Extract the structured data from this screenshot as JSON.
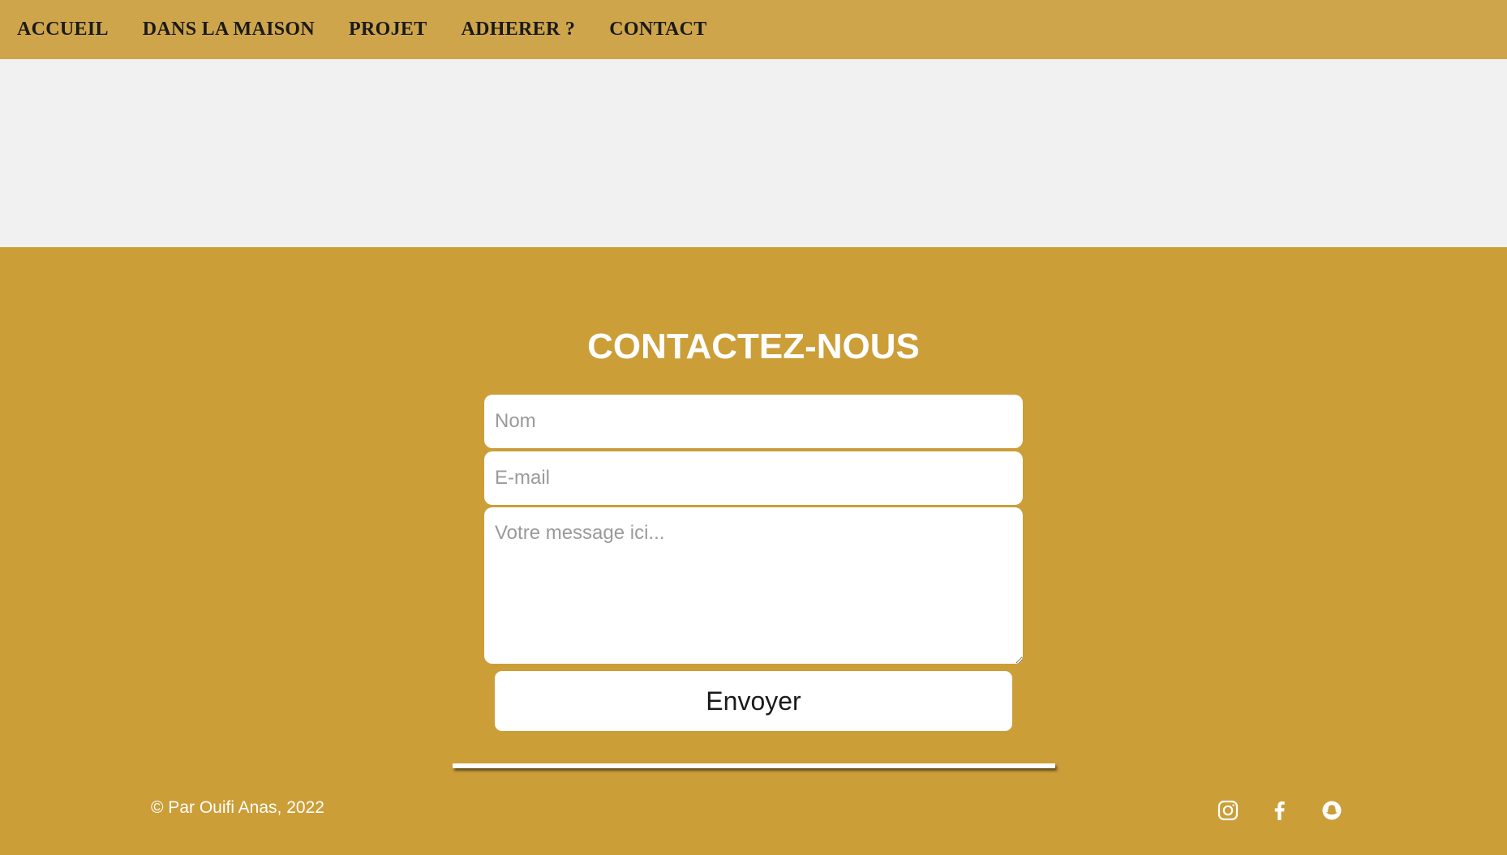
{
  "nav": {
    "items": [
      {
        "label": "ACCUEIL"
      },
      {
        "label": "DANS LA MAISON"
      },
      {
        "label": "PROJET"
      },
      {
        "label": "ADHERER ?"
      },
      {
        "label": "CONTACT"
      }
    ]
  },
  "contact": {
    "title": "CONTACTEZ-NOUS",
    "name_placeholder": "Nom",
    "email_placeholder": "E-mail",
    "message_placeholder": "Votre message ici...",
    "submit_label": "Envoyer"
  },
  "footer": {
    "copyright": "© Par Ouifi Anas, 2022",
    "social": [
      "instagram-icon",
      "facebook-icon",
      "snapchat-icon"
    ]
  },
  "colors": {
    "nav_background": "#cfa54b",
    "banner_background": "#f1f1f1",
    "section_background": "#cc9e38",
    "text_light": "#ffffff"
  }
}
